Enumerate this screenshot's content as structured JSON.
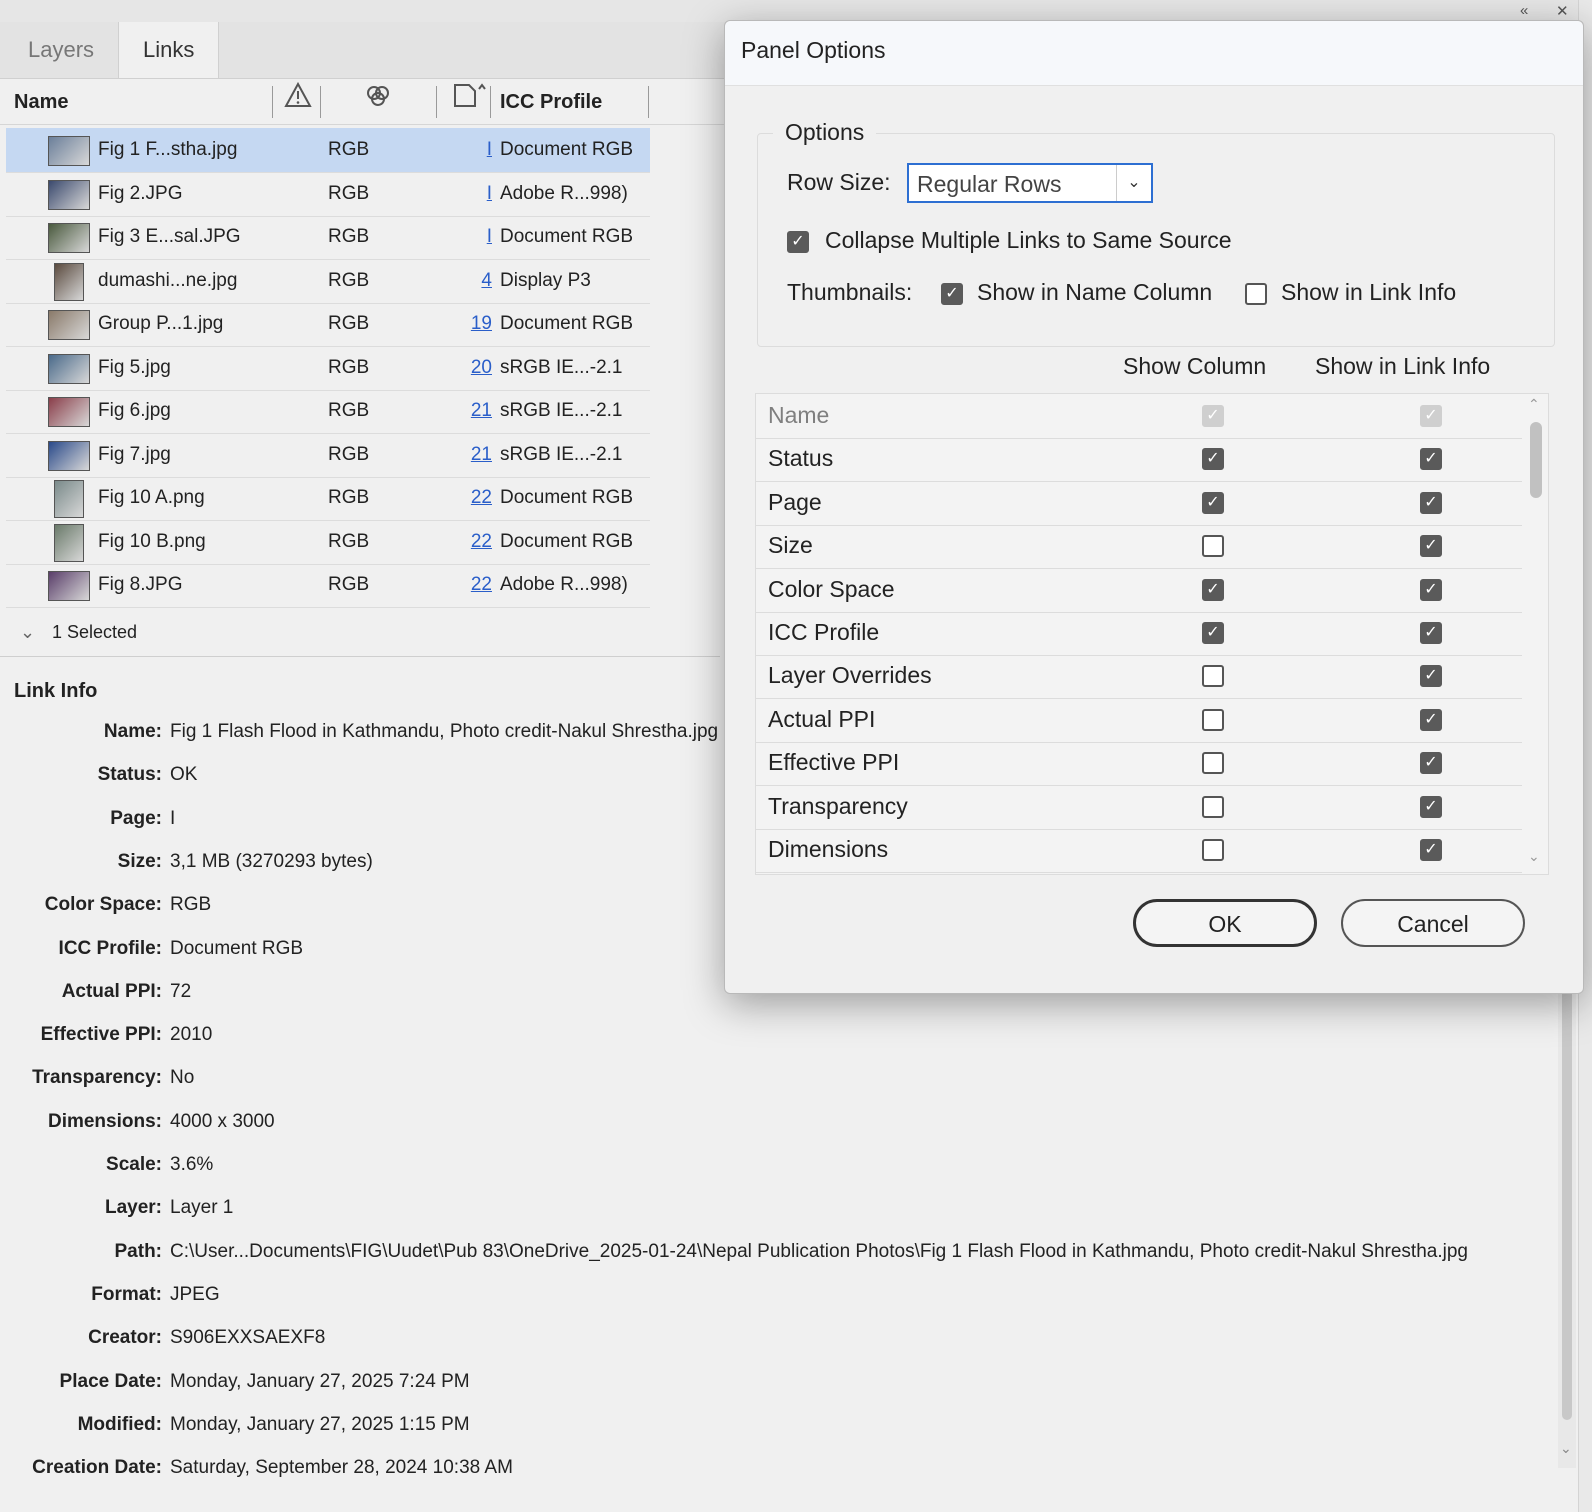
{
  "tabs": [
    "Layers",
    "Links"
  ],
  "columns": {
    "name": "Name",
    "icc": "ICC Profile"
  },
  "links": [
    {
      "name": "Fig 1 F...stha.jpg",
      "cs": "RGB",
      "page": "I",
      "icc": "Document RGB",
      "selected": true
    },
    {
      "name": "Fig 2.JPG",
      "cs": "RGB",
      "page": "I",
      "icc": "Adobe R...998)"
    },
    {
      "name": "Fig 3 E...sal.JPG",
      "cs": "RGB",
      "page": "I",
      "icc": "Document RGB"
    },
    {
      "name": "dumashi...ne.jpg",
      "cs": "RGB",
      "page": "4",
      "icc": "Display P3"
    },
    {
      "name": "Group P...1.jpg",
      "cs": "RGB",
      "page": "19",
      "icc": "Document RGB"
    },
    {
      "name": "Fig 5.jpg",
      "cs": "RGB",
      "page": "20",
      "icc": "sRGB IE...-2.1"
    },
    {
      "name": "Fig 6.jpg",
      "cs": "RGB",
      "page": "21",
      "icc": "sRGB IE...-2.1"
    },
    {
      "name": "Fig 7.jpg",
      "cs": "RGB",
      "page": "21",
      "icc": "sRGB IE...-2.1"
    },
    {
      "name": "Fig 10 A.png",
      "cs": "RGB",
      "page": "22",
      "icc": "Document RGB"
    },
    {
      "name": "Fig 10 B.png",
      "cs": "RGB",
      "page": "22",
      "icc": "Document RGB"
    },
    {
      "name": "Fig 8.JPG",
      "cs": "RGB",
      "page": "22",
      "icc": "Adobe R...998)"
    }
  ],
  "selection_label": "1 Selected",
  "link_info": {
    "title": "Link Info",
    "fields": [
      {
        "k": "Name:",
        "v": "Fig 1 Flash Flood in Kathmandu, Photo credit-Nakul Shrestha.jpg"
      },
      {
        "k": "Status:",
        "v": "OK"
      },
      {
        "k": "Page:",
        "v": "I"
      },
      {
        "k": "Size:",
        "v": "3,1 MB (3270293 bytes)"
      },
      {
        "k": "Color Space:",
        "v": "RGB"
      },
      {
        "k": "ICC Profile:",
        "v": "Document RGB"
      },
      {
        "k": "Actual PPI:",
        "v": "72"
      },
      {
        "k": "Effective PPI:",
        "v": "2010"
      },
      {
        "k": "Transparency:",
        "v": "No"
      },
      {
        "k": "Dimensions:",
        "v": "4000 x 3000"
      },
      {
        "k": "Scale:",
        "v": "3.6%"
      },
      {
        "k": "Layer:",
        "v": "Layer 1"
      },
      {
        "k": "Path:",
        "v": "C:\\User...Documents\\FIG\\Uudet\\Pub 83\\OneDrive_2025-01-24\\Nepal Publication Photos\\Fig 1 Flash Flood in Kathmandu, Photo credit-Nakul Shrestha.jpg"
      },
      {
        "k": "Format:",
        "v": "JPEG"
      },
      {
        "k": "Creator:",
        "v": "S906EXXSAEXF8"
      },
      {
        "k": "Place Date:",
        "v": "Monday, January 27, 2025 7:24 PM"
      },
      {
        "k": "Modified:",
        "v": "Monday, January 27, 2025 1:15 PM"
      },
      {
        "k": "Creation Date:",
        "v": "Saturday, September 28, 2024 10:38 AM"
      }
    ]
  },
  "dialog": {
    "title": "Panel Options",
    "group_label": "Options",
    "row_size_label": "Row Size:",
    "row_size_value": "Regular Rows",
    "collapse_label": "Collapse Multiple Links to Same Source",
    "collapse_checked": true,
    "thumbnails_label": "Thumbnails:",
    "thumb_name_label": "Show in Name Column",
    "thumb_name_checked": true,
    "thumb_info_label": "Show in Link Info",
    "thumb_info_checked": false,
    "col_show": "Show Column",
    "col_info": "Show in Link Info",
    "items": [
      {
        "label": "Name",
        "show": true,
        "info": true,
        "disabled": true
      },
      {
        "label": "Status",
        "show": true,
        "info": true
      },
      {
        "label": "Page",
        "show": true,
        "info": true
      },
      {
        "label": "Size",
        "show": false,
        "info": true
      },
      {
        "label": "Color Space",
        "show": true,
        "info": true
      },
      {
        "label": "ICC Profile",
        "show": true,
        "info": true
      },
      {
        "label": "Layer Overrides",
        "show": false,
        "info": true
      },
      {
        "label": "Actual PPI",
        "show": false,
        "info": true
      },
      {
        "label": "Effective PPI",
        "show": false,
        "info": true
      },
      {
        "label": "Transparency",
        "show": false,
        "info": true
      },
      {
        "label": "Dimensions",
        "show": false,
        "info": true
      }
    ],
    "ok": "OK",
    "cancel": "Cancel"
  },
  "icons": {
    "collapse": "double-chevron-left-icon",
    "close": "close-icon",
    "status_col": "warning-triangle-icon",
    "colorspace_col": "color-space-icon",
    "page_col": "page-icon"
  }
}
